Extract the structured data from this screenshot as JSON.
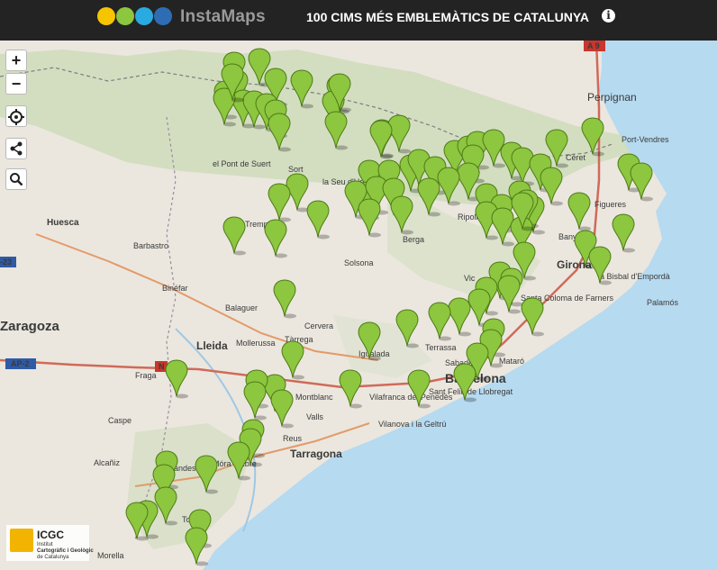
{
  "header": {
    "brand": "InstaMaps",
    "title": "100 CIMS MÉS EMBLEMÀTICS DE CATALUNYA",
    "info_icon": "info-icon",
    "logo_colors": [
      "#f7c400",
      "#8dc63f",
      "#29aae1",
      "#2e6db4"
    ]
  },
  "controls": {
    "zoom_in_label": "+",
    "zoom_out_label": "−",
    "locate_icon": "crosshair-icon",
    "share_icon": "share-icon",
    "search_icon": "search-icon"
  },
  "colors": {
    "sea": "#b6daf0",
    "land": "#e9e5dc",
    "mountain": "#cbd9b9",
    "marker": "#8dc63f",
    "marker_stroke": "#4d7a16"
  },
  "map_labels": {
    "perpignan": "Perpignan",
    "port_vendres": "Port-Vendres",
    "ceret": "Céret",
    "huesca": "Huesca",
    "barbastro": "Barbastro",
    "binefar": "Binéfar",
    "zaragoza": "Zaragoza",
    "lleida": "Lleida",
    "balaguer": "Balaguer",
    "mollerussa": "Mollerussa",
    "cervera": "Cervera",
    "tarrega": "Tàrrega",
    "solsona": "Solsona",
    "berga": "Berga",
    "la_seu": "la Seu d'Urgell",
    "el_pont_de_suert": "el Pont de Suert",
    "sort": "Sort",
    "tremp": "Tremp",
    "ripoll": "Ripoll",
    "vic": "Vic",
    "olot": "Olot",
    "girona": "Girona",
    "figueres": "Figueres",
    "banyoles": "Banyoles",
    "santa_coloma": "Santa Coloma de Farners",
    "la_bisbal": "la Bisbal d'Empordà",
    "palamos": "Palamós",
    "igualada": "Igualada",
    "terrassa": "Terrassa",
    "sabadell": "Sabadell",
    "mataro": "Mataró",
    "barcelona": "Barcelona",
    "sant_feliu": "Sant Feliu de Llobregat",
    "vilafranca": "Vilafranca del Penedès",
    "vilanova": "Vilanova i la Geltrú",
    "valls": "Valls",
    "montblanc": "Montblanc",
    "reus": "Reus",
    "tarragona": "Tarragona",
    "caspe": "Caspe",
    "alcaniz": "Alcañiz",
    "gandesa": "Gandesa",
    "mora_debre": "Móra d'Ebre",
    "tortosa": "Tortosa",
    "morella": "Morella",
    "fraga": "Fraga",
    "a9": "A 9",
    "ap2": "AP-2",
    "e23": "-23",
    "n2": "N"
  },
  "attribution": {
    "name": "ICGC",
    "line1": "Institut",
    "line2": "Cartogràfic i Geològic",
    "line3": "de Catalunya"
  },
  "markers_count_visible": 100
}
